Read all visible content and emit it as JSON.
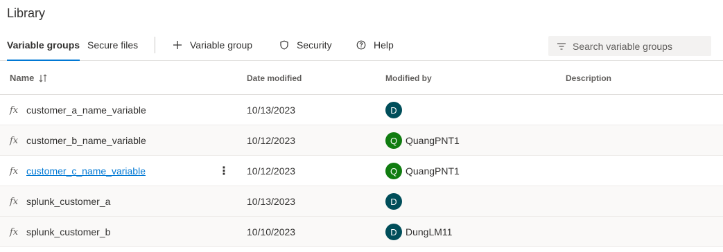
{
  "page": {
    "title": "Library"
  },
  "tabs": [
    {
      "label": "Variable groups",
      "selected": true
    },
    {
      "label": "Secure files",
      "selected": false
    }
  ],
  "commands": {
    "add_variable_group": {
      "label": "Variable group",
      "icon": "plus-icon"
    },
    "security": {
      "label": "Security",
      "icon": "shield-icon"
    },
    "help": {
      "label": "Help",
      "icon": "help-icon"
    }
  },
  "search": {
    "placeholder": "Search variable groups",
    "value": "",
    "icon": "filter-icon"
  },
  "table": {
    "columns": {
      "name": "Name",
      "date_modified": "Date modified",
      "modified_by": "Modified by",
      "description": "Description"
    },
    "rows": [
      {
        "name": "customer_a_name_variable",
        "date": "10/13/2023",
        "avatar_initial": "D",
        "avatar_color": "#004e5a",
        "modified_by": "",
        "description": ""
      },
      {
        "name": "customer_b_name_variable",
        "date": "10/12/2023",
        "avatar_initial": "Q",
        "avatar_color": "#107c10",
        "modified_by": "QuangPNT1",
        "description": ""
      },
      {
        "name": "customer_c_name_variable",
        "date": "10/12/2023",
        "avatar_initial": "Q",
        "avatar_color": "#107c10",
        "modified_by": "QuangPNT1",
        "description": "",
        "hovered": true
      },
      {
        "name": "splunk_customer_a",
        "date": "10/13/2023",
        "avatar_initial": "D",
        "avatar_color": "#004e5a",
        "modified_by": "",
        "description": ""
      },
      {
        "name": "splunk_customer_b",
        "date": "10/10/2023",
        "avatar_initial": "D",
        "avatar_color": "#004e5a",
        "modified_by": "DungLM11",
        "description": ""
      }
    ]
  },
  "colors": {
    "accent": "#0078d4"
  }
}
